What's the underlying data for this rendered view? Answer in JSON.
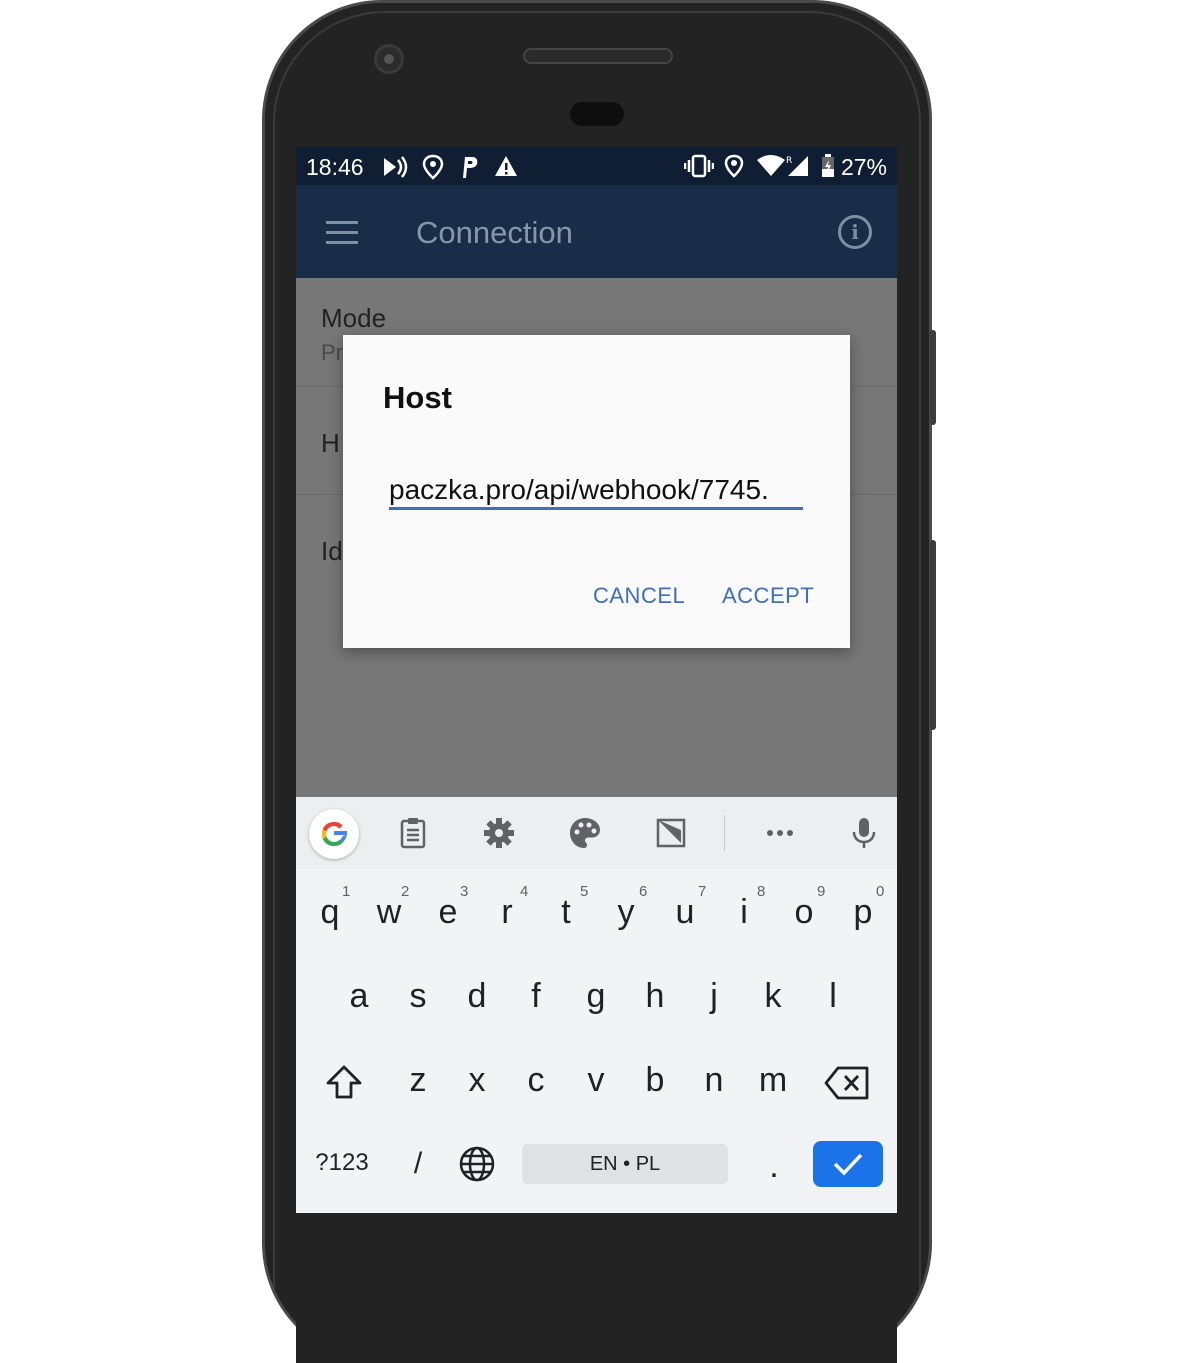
{
  "status_bar": {
    "time": "18:46",
    "battery": "27%",
    "left_icons": [
      "cast-icon",
      "location-pin-icon",
      "parking-icon",
      "warning-icon"
    ],
    "right_icons": [
      "vibrate-icon",
      "location-icon",
      "wifi-icon",
      "signal-icon",
      "battery-icon"
    ]
  },
  "appbar": {
    "title": "Connection",
    "menu_icon": "hamburger-menu-icon",
    "info_icon": "info-icon",
    "info_glyph": "i"
  },
  "preferences": [
    {
      "title": "Mode",
      "subtitle": "Pr"
    },
    {
      "title": "H",
      "subtitle": ""
    },
    {
      "title": "Id",
      "subtitle": ""
    }
  ],
  "dialog": {
    "title": "Host",
    "input_value": ".paczka.pro/api/webhook/7745",
    "cancel_label": "CANCEL",
    "accept_label": "ACCEPT"
  },
  "keyboard": {
    "toolbar_icons": [
      "google-icon",
      "clipboard-icon",
      "settings-icon",
      "palette-icon",
      "one-handed-icon",
      "more-icon",
      "microphone-icon"
    ],
    "row1": [
      "q",
      "w",
      "e",
      "r",
      "t",
      "y",
      "u",
      "i",
      "o",
      "p"
    ],
    "row1_hints": [
      "1",
      "2",
      "3",
      "4",
      "5",
      "6",
      "7",
      "8",
      "9",
      "0"
    ],
    "row2": [
      "a",
      "s",
      "d",
      "f",
      "g",
      "h",
      "j",
      "k",
      "l"
    ],
    "row3": [
      "z",
      "x",
      "c",
      "v",
      "b",
      "n",
      "m"
    ],
    "symbols_label": "?123",
    "slash_label": "/",
    "space_label": "EN • PL",
    "period_label": ".",
    "accent_color": "#1a73e8"
  }
}
